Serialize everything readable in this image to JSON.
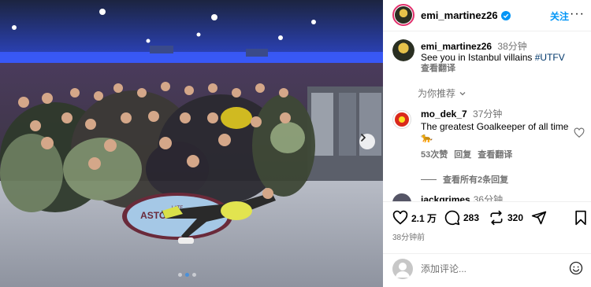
{
  "photo": {
    "banner_line1": "LATE",
    "banner_line2": "ASTON VILLA",
    "carousel_dots": 3,
    "active_dot": 2
  },
  "header": {
    "username": "emi_martinez26",
    "follow_label": "关注",
    "more_label": "···"
  },
  "caption": {
    "username": "emi_martinez26",
    "time": "38分钟",
    "text": "See you in Istanbul villains ",
    "hashtag": "#UTFV",
    "translate": "查看翻译"
  },
  "related": {
    "label": "为你推荐"
  },
  "comments": [
    {
      "username": "mo_dek_7",
      "time": "37分钟",
      "text": "The greatest Goalkeeper of all time 🐆",
      "likes": "53次赞",
      "reply": "回复",
      "translate": "查看翻译"
    }
  ],
  "view_replies": "查看所有2条回复",
  "partial_comment": {
    "username": "jackgrimes",
    "time": "36分钟"
  },
  "actions": {
    "likes": "2.1 万",
    "comments": "283",
    "reposts": "320"
  },
  "posted_time": "38分钟前",
  "add_comment": {
    "placeholder": "添加评论..."
  },
  "colors": {
    "link": "#0095f6",
    "hashtag": "#00376b",
    "muted": "#737373",
    "ring": "#e1306c"
  },
  "icons": [
    "verified-icon",
    "chevron-right-icon",
    "heart-icon",
    "comment-icon",
    "repost-icon",
    "share-icon",
    "bookmark-icon",
    "emoji-icon",
    "arrow-down-icon",
    "leopard-emoji"
  ]
}
